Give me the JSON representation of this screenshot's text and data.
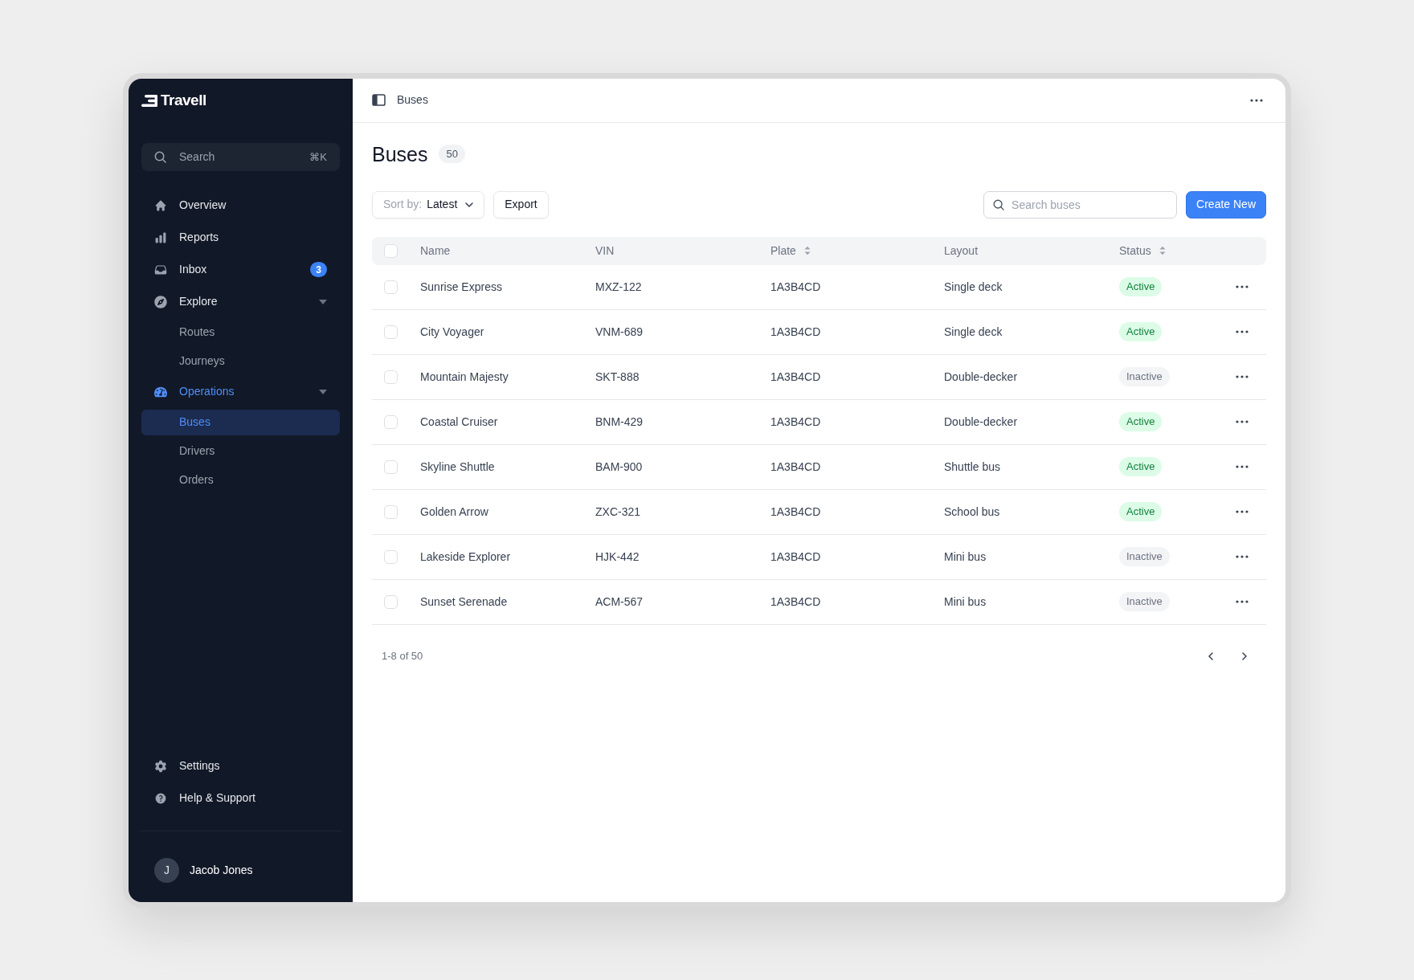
{
  "app": {
    "logo": "Travell"
  },
  "sidebar": {
    "search": {
      "placeholder": "Search",
      "shortcut": "⌘K"
    },
    "items": [
      {
        "kind": "link",
        "label": "Overview",
        "selected": false
      },
      {
        "kind": "link",
        "label": "Reports",
        "selected": false
      },
      {
        "kind": "link",
        "label": "Inbox",
        "selected": false,
        "badge": "3"
      },
      {
        "kind": "group",
        "label": "Explore",
        "selected": false,
        "expanded": true,
        "children": [
          {
            "label": "Routes",
            "selected": false
          },
          {
            "label": "Journeys",
            "selected": false
          }
        ]
      },
      {
        "kind": "group",
        "label": "Operations",
        "selected": true,
        "expanded": true,
        "children": [
          {
            "label": "Buses",
            "selected": true
          },
          {
            "label": "Drivers",
            "selected": false
          },
          {
            "label": "Orders",
            "selected": false
          }
        ]
      }
    ],
    "footer_items": [
      {
        "label": "Settings",
        "selected": false
      },
      {
        "label": "Help & Support",
        "selected": false
      }
    ],
    "user": {
      "initial": "J",
      "name": "Jacob Jones"
    }
  },
  "header": {
    "breadcrumb": "Buses"
  },
  "page": {
    "title": "Buses",
    "count": "50"
  },
  "toolbar": {
    "sort": {
      "label": "Sort by:",
      "value": "Latest"
    },
    "export": "Export",
    "search": {
      "placeholder": "Search buses"
    },
    "create": "Create New"
  },
  "table": {
    "select_all": {
      "checked": false
    },
    "columns": [
      {
        "label": "Name",
        "sortable": false
      },
      {
        "label": "VIN",
        "sortable": false
      },
      {
        "label": "Plate",
        "sortable": true
      },
      {
        "label": "Layout",
        "sortable": false
      },
      {
        "label": "Status",
        "sortable": true
      }
    ],
    "rows": [
      {
        "checked": false,
        "name": "Sunrise Express",
        "vin": "MXZ-122",
        "plate": "1A3B4CD",
        "layout": "Single deck",
        "status": "Active",
        "active": true
      },
      {
        "checked": false,
        "name": "City Voyager",
        "vin": "VNM-689",
        "plate": "1A3B4CD",
        "layout": "Single deck",
        "status": "Active",
        "active": true
      },
      {
        "checked": false,
        "name": "Mountain Majesty",
        "vin": "SKT-888",
        "plate": "1A3B4CD",
        "layout": "Double-decker",
        "status": "Inactive",
        "active": false
      },
      {
        "checked": false,
        "name": "Coastal Cruiser",
        "vin": "BNM-429",
        "plate": "1A3B4CD",
        "layout": "Double-decker",
        "status": "Active",
        "active": true
      },
      {
        "checked": false,
        "name": "Skyline Shuttle",
        "vin": "BAM-900",
        "plate": "1A3B4CD",
        "layout": "Shuttle bus",
        "status": "Active",
        "active": true
      },
      {
        "checked": false,
        "name": "Golden Arrow",
        "vin": "ZXC-321",
        "plate": "1A3B4CD",
        "layout": "School bus",
        "status": "Active",
        "active": true
      },
      {
        "checked": false,
        "name": "Lakeside Explorer",
        "vin": "HJK-442",
        "plate": "1A3B4CD",
        "layout": "Mini bus",
        "status": "Inactive",
        "active": false
      },
      {
        "checked": false,
        "name": "Sunset Serenade",
        "vin": "ACM-567",
        "plate": "1A3B4CD",
        "layout": "Mini bus",
        "status": "Inactive",
        "active": false
      }
    ]
  },
  "pagination": {
    "range": "1-8 of 50"
  }
}
